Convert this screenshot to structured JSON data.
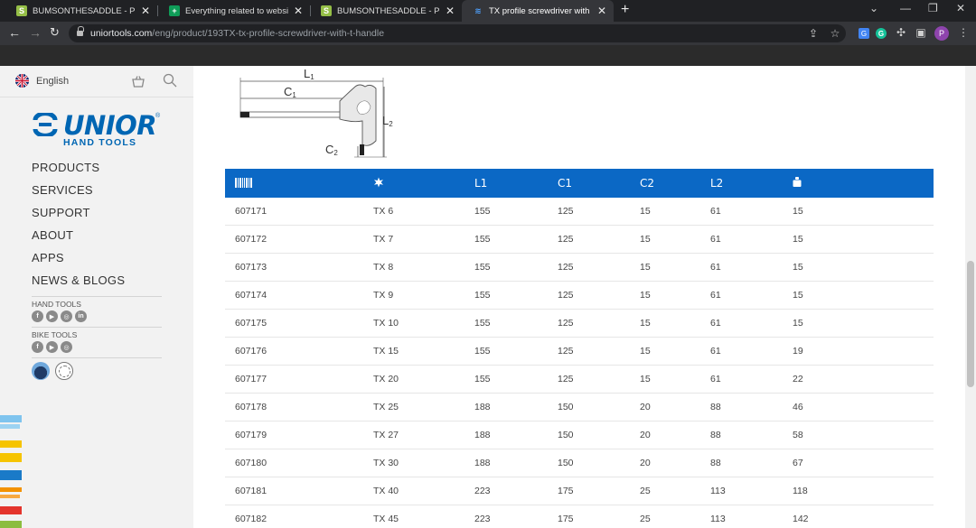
{
  "browser": {
    "tabs": [
      {
        "title": "BUMSONTHESADDLE - Products",
        "favicon": "shopify-icon",
        "active": false
      },
      {
        "title": "Everything related to website up",
        "favicon": "sheets-icon",
        "active": false
      },
      {
        "title": "BUMSONTHESADDLE - Products",
        "favicon": "shopify-icon",
        "active": false
      },
      {
        "title": "TX profile screwdriver with T-han",
        "favicon": "unior-icon",
        "active": true
      }
    ],
    "url_domain": "uniortools.com",
    "url_path": "/eng/product/193TX-tx-profile-screwdriver-with-t-handle",
    "profile_initial": "P"
  },
  "sidebar": {
    "language": "English",
    "logo_text": "UNIOR",
    "logo_registered": "®",
    "logo_sub": "HAND TOOLS",
    "menu": [
      "PRODUCTS",
      "SERVICES",
      "SUPPORT",
      "ABOUT",
      "APPS",
      "NEWS & BLOGS"
    ],
    "hand_tools_label": "HAND TOOLS",
    "bike_tools_label": "BIKE TOOLS",
    "hand_tools_social": [
      "facebook-icon",
      "youtube-icon",
      "instagram-icon",
      "linkedin-icon"
    ],
    "bike_tools_social": [
      "facebook-icon",
      "youtube-icon",
      "instagram-icon"
    ]
  },
  "diagram": {
    "labels": {
      "l1": "L",
      "l1_sub": "1",
      "c1": "C",
      "c1_sub": "1",
      "l2": "L",
      "l2_sub": "2",
      "c2": "C",
      "c2_sub": "2"
    }
  },
  "table": {
    "headers": [
      "barcode-icon",
      "star-icon",
      "L1",
      "C1",
      "C2",
      "L2",
      "weight-icon"
    ],
    "header_labels": {
      "l1": "L1",
      "c1": "C1",
      "c2": "C2",
      "l2": "L2"
    },
    "rows": [
      [
        "607171",
        "TX 6",
        "155",
        "125",
        "15",
        "61",
        "15"
      ],
      [
        "607172",
        "TX 7",
        "155",
        "125",
        "15",
        "61",
        "15"
      ],
      [
        "607173",
        "TX 8",
        "155",
        "125",
        "15",
        "61",
        "15"
      ],
      [
        "607174",
        "TX 9",
        "155",
        "125",
        "15",
        "61",
        "15"
      ],
      [
        "607175",
        "TX 10",
        "155",
        "125",
        "15",
        "61",
        "15"
      ],
      [
        "607176",
        "TX 15",
        "155",
        "125",
        "15",
        "61",
        "19"
      ],
      [
        "607177",
        "TX 20",
        "155",
        "125",
        "15",
        "61",
        "22"
      ],
      [
        "607178",
        "TX 25",
        "188",
        "150",
        "20",
        "88",
        "46"
      ],
      [
        "607179",
        "TX 27",
        "188",
        "150",
        "20",
        "88",
        "58"
      ],
      [
        "607180",
        "TX 30",
        "188",
        "150",
        "20",
        "88",
        "67"
      ],
      [
        "607181",
        "TX 40",
        "223",
        "175",
        "25",
        "113",
        "118"
      ],
      [
        "607182",
        "TX 45",
        "223",
        "175",
        "25",
        "113",
        "142"
      ]
    ]
  },
  "colors": {
    "brand_blue": "#0066b3",
    "table_header": "#0b68c5",
    "sidebar_bg": "#f2f2f2"
  }
}
